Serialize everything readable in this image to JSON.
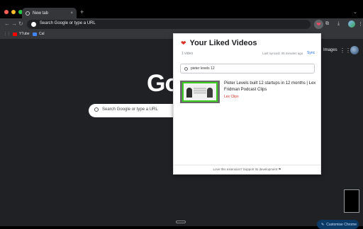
{
  "browser": {
    "tab": {
      "title": "New tab",
      "close": "×"
    },
    "new_tab": "+",
    "omnibox": {
      "text": "Search Google or type a URL"
    },
    "nav": {
      "back": "←",
      "forward": "→",
      "reload": "↻"
    },
    "bookmarks": [
      {
        "label": "YTube",
        "color": "#ff0000"
      },
      {
        "label": "Cal",
        "color": "#4285f4"
      }
    ],
    "toolbar_icons": {
      "extension": "❤",
      "puzzle": "⧉",
      "download": "⤓",
      "menu": "⋮"
    }
  },
  "ntp": {
    "images_link": "Images",
    "apps_icon": "⋮⋮",
    "logo": "Go",
    "search_placeholder": "Search Google or type a URL",
    "customise_label": "Customise Chrome"
  },
  "popup": {
    "heart": "❤",
    "title": "Your Liked Videos",
    "count": "1 video",
    "sync_status": "Last synced: 30 minutes ago",
    "sync_label": "Sync",
    "search_value": "pieter levels 12",
    "results": [
      {
        "title": "Pieter Levels built 12 startups in 12 months | Lex Fridman Podcast Clips",
        "channel": "Lex Clips"
      }
    ],
    "footer": "Love this extension? Support its development ⚑"
  },
  "colors": {
    "accent": "#1a73e8",
    "heart": "#d93025",
    "thumb_border": "#3acd1f"
  }
}
